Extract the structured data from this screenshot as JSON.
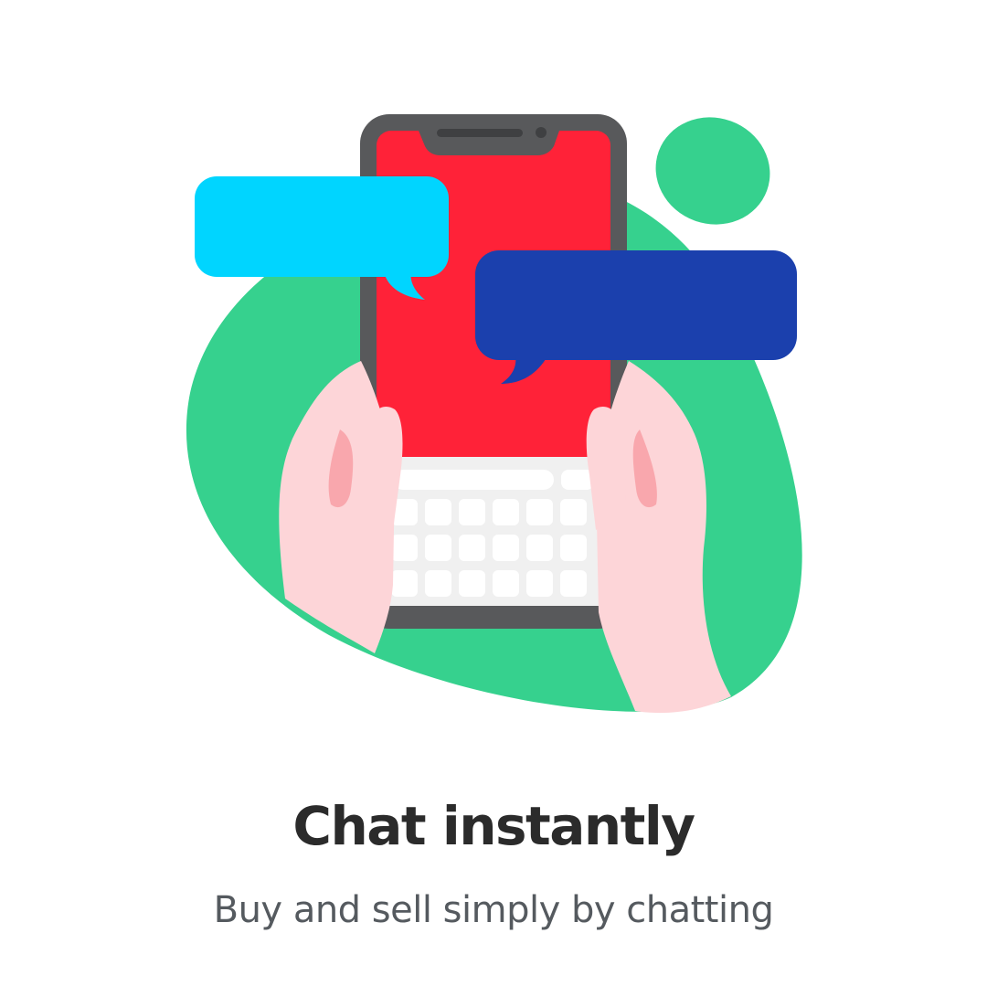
{
  "onboarding": {
    "title": "Chat instantly",
    "subtitle": "Buy and sell simply by chatting"
  },
  "illustration": {
    "icon": "phone-chat-illustration",
    "colors": {
      "blob": "#36d18e",
      "phone_frame": "#58595b",
      "screen": "#ff2238",
      "keyboard": "#f0f0f0",
      "bubble_left": "#00d5ff",
      "bubble_right": "#1b40ad",
      "hand": "#fdd5d8",
      "thumb_shadow": "#f9a7ad"
    }
  }
}
